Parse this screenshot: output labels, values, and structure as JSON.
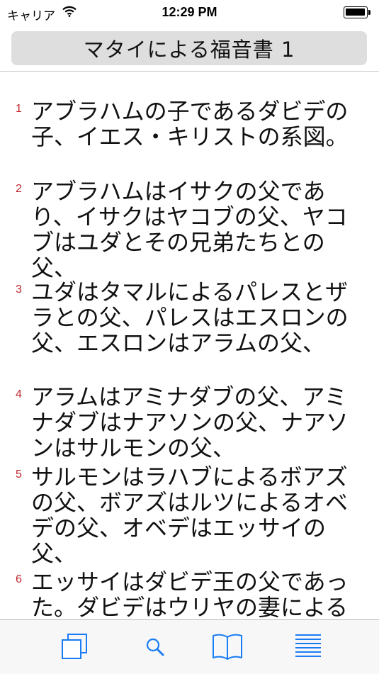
{
  "status_bar": {
    "carrier": "キャリア",
    "time": "12:29 PM"
  },
  "header": {
    "title": "マタイによる福音書 1"
  },
  "verses": [
    {
      "number": "1",
      "text": "アブラハムの子であるダビデの子、イエス・キリストの系図。"
    },
    {
      "number": "2",
      "text": "アブラハムはイサクの父であり、イサクはヤコブの父、ヤコブはユダとその兄弟たちとの父、"
    },
    {
      "number": "3",
      "text": "ユダはタマルによるパレスとザラとの父、パレスはエスロンの父、エスロンはアラムの父、"
    },
    {
      "number": "4",
      "text": "アラムはアミナダブの父、アミナダブはナアソンの父、ナアソンはサルモンの父、"
    },
    {
      "number": "5",
      "text": "サルモンはラハブによるボアズの父、ボアズはルツによるオベデの父、オベデはエッサイの父、"
    },
    {
      "number": "6",
      "text": "エッサイはダビデ王の父であった。ダビデはウリヤの妻による"
    }
  ],
  "tab_bar": {
    "accent_color": "#1a7cf5",
    "items": [
      {
        "icon": "copy-icon"
      },
      {
        "icon": "search-icon"
      },
      {
        "icon": "book-icon"
      },
      {
        "icon": "list-icon"
      }
    ]
  }
}
